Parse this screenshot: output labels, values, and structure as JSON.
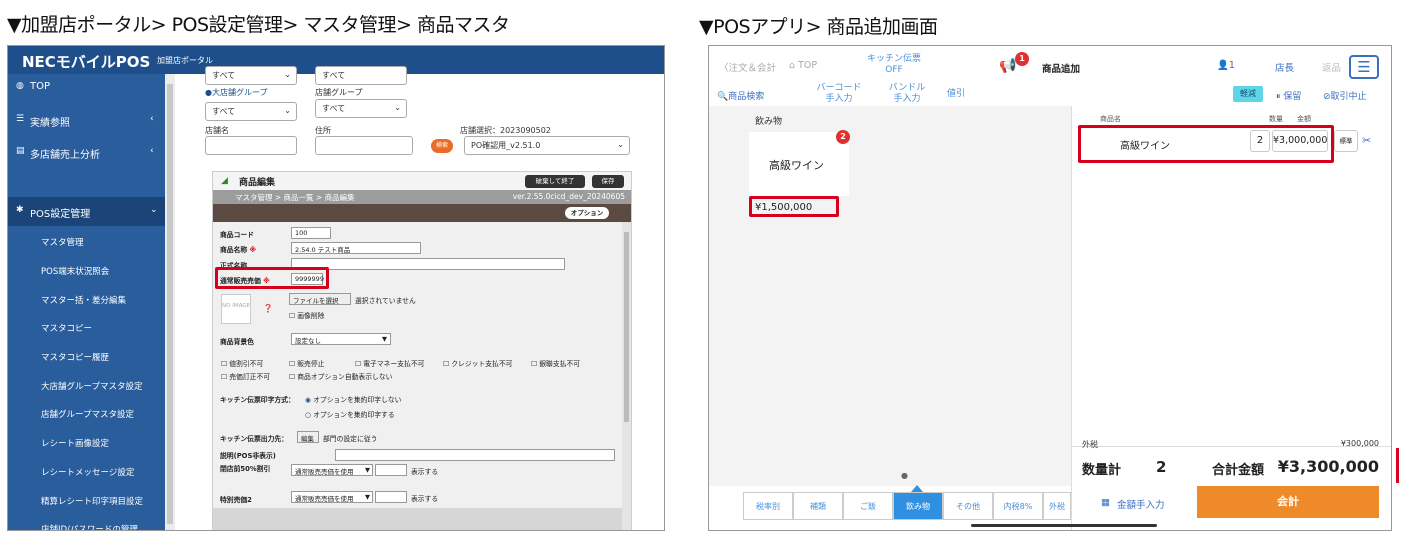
{
  "captions": {
    "left": "▼加盟店ポータル> POS設定管理> マスタ管理> 商品マスタ",
    "right": "▼POSアプリ> 商品追加画面"
  },
  "portal": {
    "brand": "NECモバイルPOS",
    "brand_sub": "加盟店ポータル",
    "sidebar": [
      {
        "icon": "dashboard-icon",
        "label": "TOP",
        "chevron": ""
      },
      {
        "icon": "list-icon",
        "label": "実績参照",
        "chevron": "‹"
      },
      {
        "icon": "database-icon",
        "label": "多店舗売上分析",
        "chevron": "‹"
      },
      {
        "icon": "gear-icon",
        "label": "POS設定管理",
        "chevron": "⌄"
      }
    ],
    "subitems": [
      "マスタ管理",
      "POS端末状況照会",
      "マスター括・差分編集",
      "マスタコピー",
      "マスタコピー履歴",
      "大店舗グループマスタ設定",
      "店舗グループマスタ設定",
      "レシート画像設定",
      "レシートメッセージ設定",
      "精算レシート印字項目設定",
      "店舗ID/パスワードの管理"
    ],
    "filters": {
      "top_sel1": "すべて",
      "top_sel2": "すべて",
      "radio_label": "●大店舗グループ",
      "group_label": "店舗グループ",
      "sel_big": "すべて",
      "sel_group": "すべて",
      "store_name": "店舗名",
      "address": "住所",
      "search": "検索",
      "store_select_label": "店舗選択：2023090502",
      "store_select_value": "PO確認用_v2.51.0"
    },
    "editor": {
      "title": "商品編集",
      "discard_btn": "破棄して終了",
      "save_btn": "保存",
      "breadcrumb": "マスタ管理 > 商品一覧 > 商品編集",
      "version": "ver.2.55.0cicd_dev_20240605",
      "option_btn": "オプション",
      "fields": {
        "code_label": "商品コード",
        "code_value": "100",
        "name_label": "商品名称",
        "name_value": "2.54.0 テスト商品",
        "formal_label": "正式名称",
        "price_label": "通常販売売価",
        "price_value": "9999999",
        "noimage": "NO IMAGE",
        "file_btn": "ファイルを選択",
        "file_status": "選択されていません",
        "img_delete": "画像削除",
        "bg_label": "商品背景色",
        "bg_value": "設定なし",
        "cb1": "値割引不可",
        "cb2": "販売停止",
        "cb3": "電子マネー支払不可",
        "cb4": "クレジット支払不可",
        "cb5": "銀聯支払不可",
        "cb6": "売価訂正不可",
        "cb7": "商品オプション自動表示しない",
        "kitchen_label": "キッチン伝票印字方式：",
        "kitchen_opt1": "オプションを集約印字しない",
        "kitchen_opt2": "オプションを集約印字する",
        "kitchen_out_label": "キッチン伝票出力先：",
        "edit_btn": "編集",
        "kitchen_out_value": "部門の設定に従う",
        "desc_label": "説明(POS非表示)",
        "discount_label": "閉店前50%割引",
        "discount_sel": "通常販売売価を使用",
        "show_label": "表示する",
        "special_label": "特別売価2",
        "special_sel": "通常販売売価を使用",
        "show_label2": "表示する"
      }
    }
  },
  "pos": {
    "back": "〈注文＆会計",
    "top": "⌂ TOP",
    "kitchen": "キッチン伝票",
    "kitchen_state": "OFF",
    "notif_count": "1",
    "screen_title": "商品追加",
    "user_count": "1",
    "manager": "店長",
    "return": "返品",
    "search": "商品検索",
    "barcode1": "バーコード",
    "barcode2": "手入力",
    "bundle1": "バンドル",
    "bundle2": "手入力",
    "discount": "値引",
    "tax_reduced": "軽減",
    "hold": "保留",
    "cancel": "取引中止",
    "category": "飲み物",
    "product": "高級ワイン",
    "product_badge": "2",
    "product_price": "¥1,500,000",
    "cart_headers": [
      "商品名",
      "数量",
      "金額"
    ],
    "cart_item": {
      "name": "高級ワイン",
      "qty": "2",
      "amount": "¥3,000,000",
      "tag": "標準"
    },
    "tax_label": "外税",
    "tax_value": "¥300,000",
    "qty_total_label": "数量計",
    "qty_total": "2",
    "total_label": "合計金額",
    "total_value": "¥3,300,000",
    "tabs": [
      "税率別",
      "補類",
      "ご飯",
      "飲み物",
      "その他",
      "内税8%",
      "外税"
    ],
    "manual_btn": "金額手入力",
    "pay_btn": "会計"
  },
  "colors": {
    "portal_header": "#1f4f8b",
    "portal_sidebar": "#2a5d9c",
    "highlight_red": "#d6001c",
    "pos_accent": "#4a90d9",
    "pay_orange": "#ef8a2b"
  }
}
